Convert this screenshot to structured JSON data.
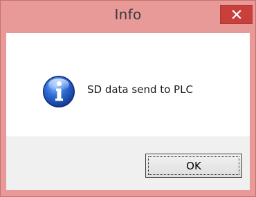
{
  "window": {
    "title": "Info",
    "close_label": "close"
  },
  "dialog": {
    "icon": "info-icon",
    "message": "SD data send to PLC",
    "ok_label": "OK"
  },
  "colors": {
    "frame": "#e79a98",
    "close_button": "#c8403b",
    "footer": "#f0f0f0"
  }
}
